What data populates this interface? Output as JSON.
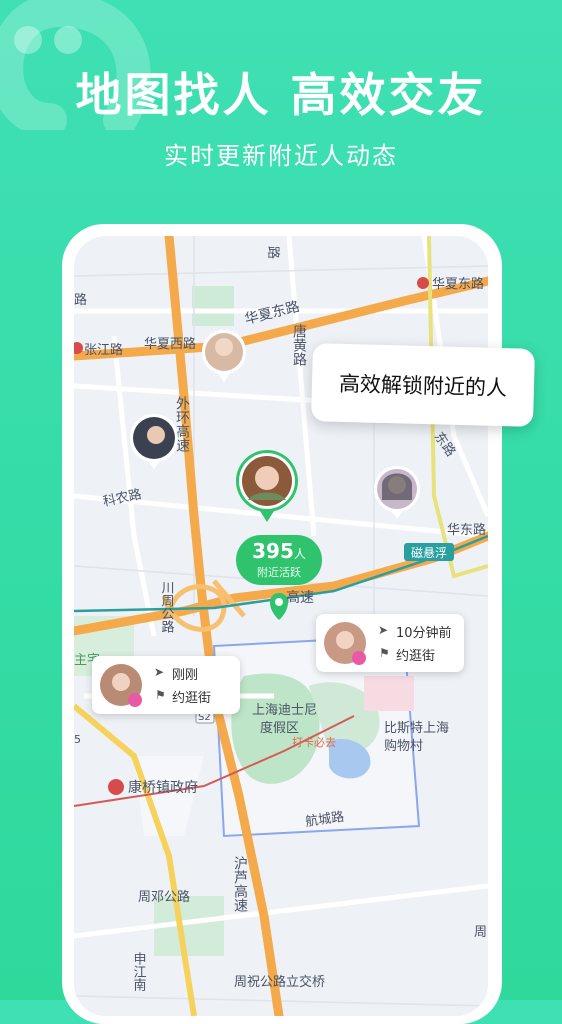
{
  "header": {
    "title": "地图找人 高效交友",
    "subtitle": "实时更新附近人动态"
  },
  "tip": "高效解锁附近的人",
  "nearby": {
    "count": "395",
    "unit": "人",
    "label": "附近活跃"
  },
  "cards": [
    {
      "time": "10分钟前",
      "activity": "约逛街"
    },
    {
      "time": "刚刚",
      "activity": "约逛街"
    }
  ],
  "map_labels": {
    "road1": "路",
    "road2": "路",
    "huaxia_east_road": "华夏东路",
    "huaxia_east_road_badge": "华夏东路",
    "tanghuang_road": "唐黄路",
    "zhangjiang_road": "张江路",
    "huaxia_west_road": "华夏西路",
    "outer_ring": "外环高速",
    "kenong_road": "科农路",
    "east_road": "东路",
    "huadong_road": "华东路",
    "maglev": "磁悬浮",
    "chuanzhou_road": "川周公路",
    "expressway": "高速",
    "zhuzhai": "主宅",
    "disney": "上海迪士尼度假区",
    "disney_tag": "打卡必去",
    "bicester": "比斯特上海购物村",
    "s2": "S2",
    "num5": "5",
    "kangqiao": "康桥镇政府",
    "hangcheng_road": "航城路",
    "hulu_expressway": "沪芦高速",
    "zhoudeng_road": "周邓公路",
    "shenjiang_road": "申江南",
    "zhouzhu_interchange": "周祝公路立交桥",
    "zhou": "周"
  },
  "colors": {
    "accent": "#2fc36d",
    "background": "#3fe0b4",
    "highway": "#f4a94b"
  }
}
